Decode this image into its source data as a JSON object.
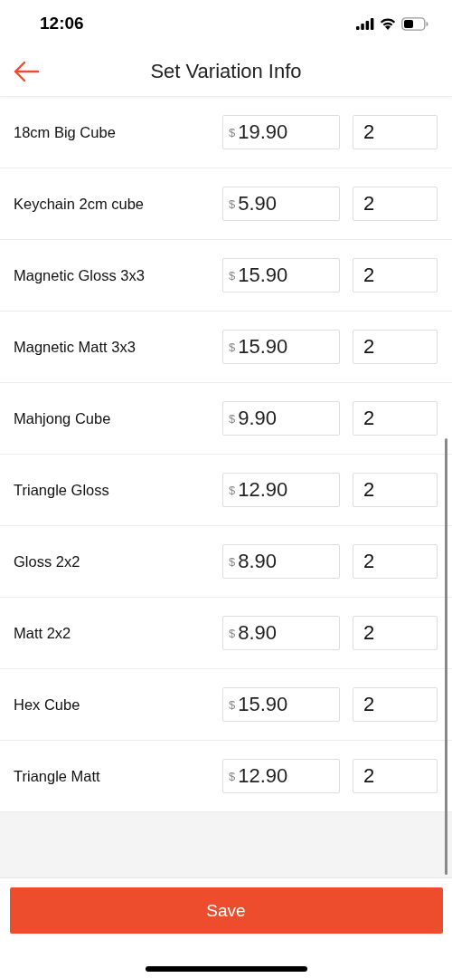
{
  "status_bar": {
    "time": "12:06"
  },
  "header": {
    "title": "Set Variation Info"
  },
  "variations": [
    {
      "name": "18cm Big Cube",
      "currency": "$",
      "price": "19.90",
      "quantity": "2"
    },
    {
      "name": "Keychain 2cm cube",
      "currency": "$",
      "price": "5.90",
      "quantity": "2"
    },
    {
      "name": "Magnetic Gloss 3x3",
      "currency": "$",
      "price": "15.90",
      "quantity": "2"
    },
    {
      "name": "Magnetic Matt 3x3",
      "currency": "$",
      "price": "15.90",
      "quantity": "2"
    },
    {
      "name": "Mahjong Cube",
      "currency": "$",
      "price": "9.90",
      "quantity": "2"
    },
    {
      "name": "Triangle Gloss",
      "currency": "$",
      "price": "12.90",
      "quantity": "2"
    },
    {
      "name": "Gloss 2x2",
      "currency": "$",
      "price": "8.90",
      "quantity": "2"
    },
    {
      "name": "Matt 2x2",
      "currency": "$",
      "price": "8.90",
      "quantity": "2"
    },
    {
      "name": "Hex Cube",
      "currency": "$",
      "price": "15.90",
      "quantity": "2"
    },
    {
      "name": "Triangle Matt",
      "currency": "$",
      "price": "12.90",
      "quantity": "2"
    }
  ],
  "save_button": {
    "label": "Save"
  }
}
